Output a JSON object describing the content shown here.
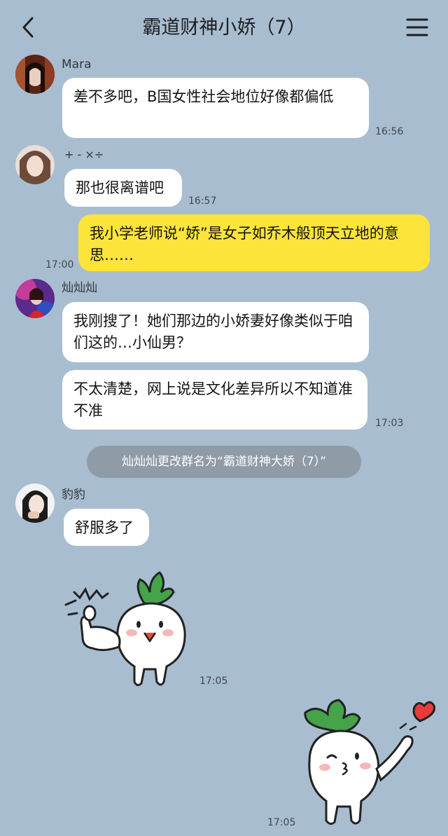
{
  "header": {
    "title": "霸道财神小娇（7）",
    "back_icon": "chevron-left-icon",
    "menu_icon": "hamburger-menu-icon"
  },
  "messages": [
    {
      "sender": "Mara",
      "text": "差不多吧，B国女性社会地位好像都偏低",
      "time": "16:56"
    },
    {
      "sender": "+ - ×÷",
      "text": "那也很离谱吧",
      "time": "16:57"
    },
    {
      "sender": "me",
      "text": "我小学老师说“娇”是女子如乔木般顶天立地的意思……",
      "time": "17:00"
    },
    {
      "sender": "灿灿灿",
      "text": "我刚搜了！她们那边的小娇妻好像类似于咱们这的…小仙男？"
    },
    {
      "sender": "灿灿灿",
      "text": "不太清楚，网上说是文化差异所以不知道准不准",
      "time": "17:03"
    },
    {
      "sender": "豹豹",
      "text": "舒服多了"
    },
    {
      "sender": "豹豹",
      "sticker": "radish-thumbs-up-sticker",
      "time": "17:05"
    },
    {
      "sender": "me",
      "sticker": "radish-kiss-heart-sticker",
      "time": "17:05"
    }
  ],
  "system_notice": "灿灿灿更改群名为“霸道财神大娇（7）”",
  "colors": {
    "background": "#a9bdd0",
    "my_bubble": "#fce43b",
    "other_bubble": "#ffffff",
    "system_pill": "#8f9ba7",
    "radish_leaf": "#45a34a"
  }
}
